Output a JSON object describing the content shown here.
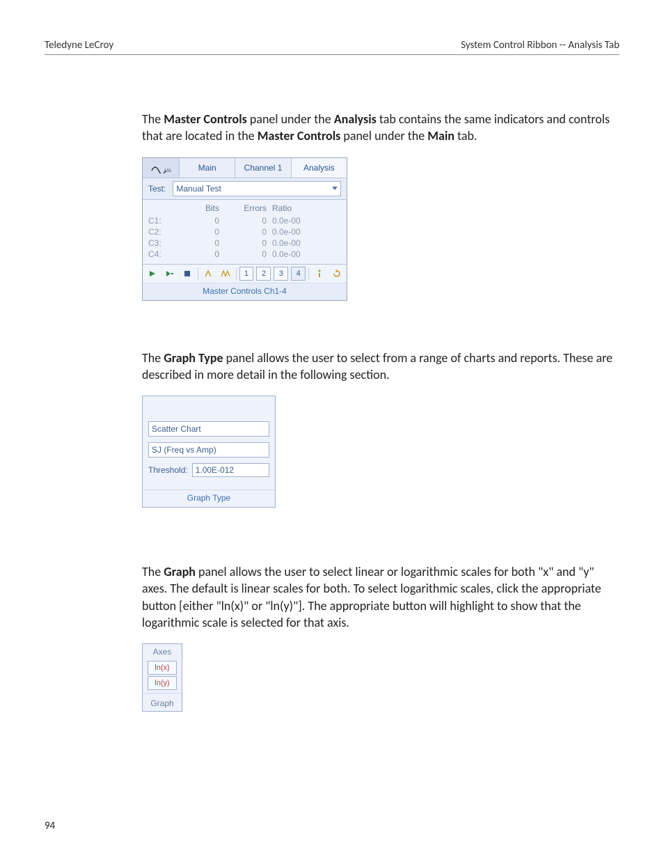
{
  "header": {
    "left": "Teledyne LeCroy",
    "right": "System Control Ribbon -- Analysis Tab"
  },
  "page_number": "94",
  "para1": {
    "t1": "The ",
    "b1": "Master Controls",
    "t2": " panel under the ",
    "b2": "Analysis",
    "t3": " tab contains the same indicators and controls that are located in the ",
    "b3": "Master Controls",
    "t4": " panel under the ",
    "b4": "Main",
    "t5": " tab."
  },
  "mc": {
    "tabs": {
      "main": "Main",
      "channel1": "Channel 1",
      "analysis": "Analysis"
    },
    "test_label": "Test:",
    "test_value": "Manual Test",
    "columns": {
      "bits": "Bits",
      "errors": "Errors",
      "ratio": "Ratio"
    },
    "rows": [
      {
        "label": "C1:",
        "bits": "0",
        "errors": "0",
        "ratio": "0.0e-00"
      },
      {
        "label": "C2:",
        "bits": "0",
        "errors": "0",
        "ratio": "0.0e-00"
      },
      {
        "label": "C3:",
        "bits": "0",
        "errors": "0",
        "ratio": "0.0e-00"
      },
      {
        "label": "C4:",
        "bits": "0",
        "errors": "0",
        "ratio": "0.0e-00"
      }
    ],
    "toolbar": {
      "play_icon": "play-icon",
      "rerun_icon": "rerun-icon",
      "stop_icon": "stop-icon",
      "inject1_icon": "inject-single-icon",
      "injectN_icon": "inject-burst-icon",
      "ch1": "1",
      "ch2": "2",
      "ch3": "3",
      "ch4": "4",
      "info_icon": "info-icon",
      "reset_icon": "reset-icon"
    },
    "footer": "Master Controls Ch1-4"
  },
  "para2": {
    "t1": "The ",
    "b1": "Graph Type",
    "t2": " panel allows the user to select from a range of charts and reports. These are described in more detail in the following section."
  },
  "gt": {
    "chart_type": "Scatter Chart",
    "series": "SJ (Freq vs Amp)",
    "threshold_label": "Threshold:",
    "threshold_value": "1.00E-012",
    "footer": "Graph Type"
  },
  "para3": {
    "t1": "The ",
    "b1": "Graph",
    "t2": " panel allows the user to select linear or logarithmic scales for both \"x\" and \"y\" axes. The default is linear scales for both. To select logarithmic scales, click the appropriate button [either \"ln(x)\" or \"ln(y)\"]. The appropriate button will highlight to show that the logarithmic scale is selected for that axis."
  },
  "gr": {
    "axes_label": "Axes",
    "lnx": "ln(x)",
    "lny": "ln(y)",
    "footer": "Graph"
  }
}
